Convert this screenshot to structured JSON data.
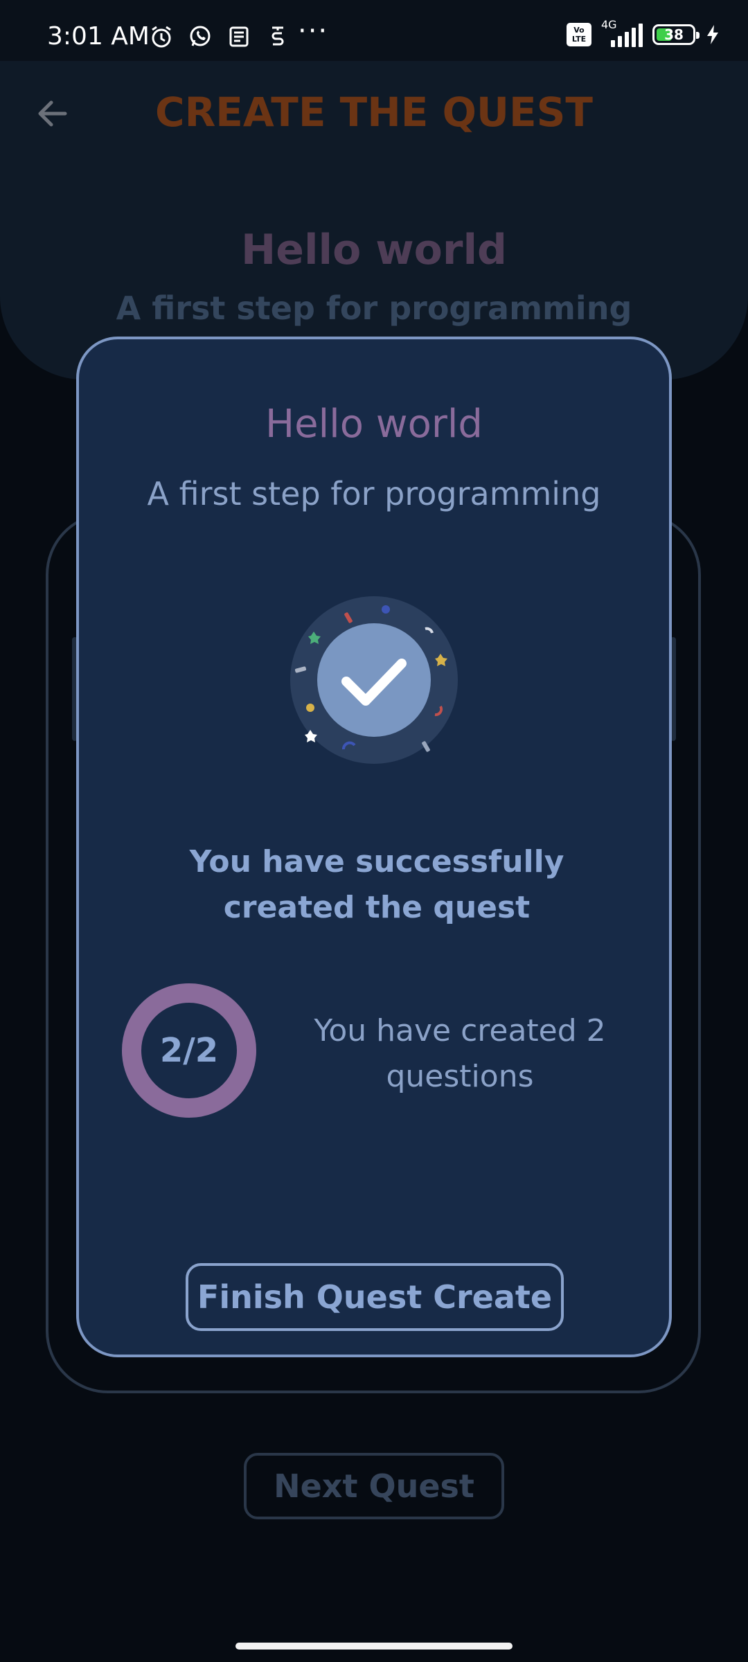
{
  "status_bar": {
    "time": "3:01 AM",
    "volte_line1": "Vo",
    "volte_line2": "LTE",
    "network": "4G",
    "battery_level": "38",
    "icons": [
      "alarm-icon",
      "whatsapp-icon",
      "news-icon",
      "app-icon",
      "more-dots-icon",
      "volte-icon",
      "signal-icon",
      "battery-icon",
      "charging-icon"
    ],
    "more": "···"
  },
  "header": {
    "title": "CREATE THE QUEST",
    "back_icon": "back-arrow-icon"
  },
  "background": {
    "quest_title": "Hello world",
    "quest_subtitle": "A first step for programming",
    "next_button": "Next Quest"
  },
  "modal": {
    "title": "Hello world",
    "subtitle": "A first step for programming",
    "illustration": "success-check-icon",
    "success_message": "You have successfully created the quest",
    "progress": {
      "label": "2/2",
      "completed": 2,
      "total": 2
    },
    "count_message": "You have created 2 questions",
    "finish_button": "Finish Quest Create"
  },
  "colors": {
    "background": "#060b12",
    "modal_bg": "#172a47",
    "modal_border": "#7d97c4",
    "accent_purple": "#8a6b9b",
    "accent_blue": "#8ba6d3",
    "header_title": "#6b3414"
  }
}
